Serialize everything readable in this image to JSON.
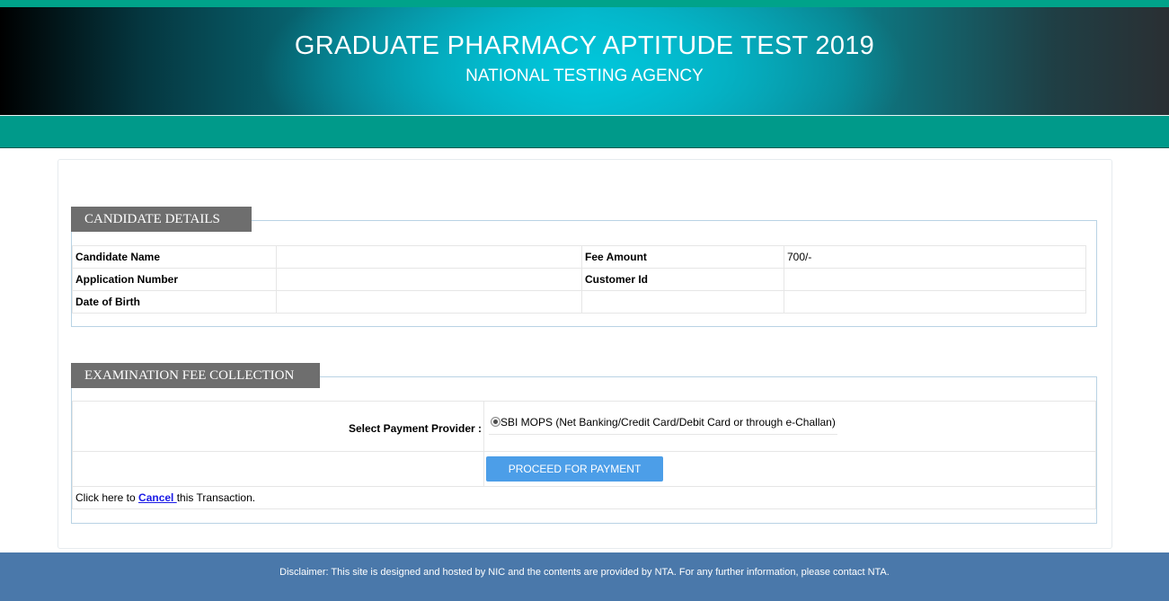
{
  "header": {
    "title": "GRADUATE PHARMACY APTITUDE TEST 2019",
    "subtitle": "NATIONAL TESTING AGENCY"
  },
  "candidate": {
    "legend": "CANDIDATE DETAILS",
    "rows": [
      {
        "label1": "Candidate Name",
        "value1": "",
        "label2": "Fee Amount",
        "value2": "700/-"
      },
      {
        "label1": "Application Number",
        "value1": "",
        "label2": "Customer Id",
        "value2": ""
      },
      {
        "label1": "Date of Birth",
        "value1": "",
        "label2": "",
        "value2": ""
      }
    ]
  },
  "fee": {
    "legend": "EXAMINATION FEE COLLECTION",
    "provider_label": "Select Payment Provider :",
    "provider_option": "SBI MOPS (Net Banking/Credit Card/Debit Card or through e-Challan)",
    "proceed_label": "PROCEED FOR PAYMENT",
    "cancel_prefix": "Click here to ",
    "cancel_link": "Cancel ",
    "cancel_suffix": "this Transaction."
  },
  "footer": {
    "disclaimer": "Disclaimer: This site is designed and hosted by NIC and the contents are provided by NTA. For any further information, please contact NTA."
  }
}
